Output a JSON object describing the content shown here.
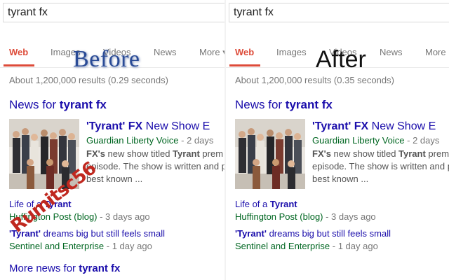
{
  "panels": {
    "before": {
      "query": "tyrant fx",
      "label": "Before",
      "tabs": [
        "Web",
        "Images",
        "Videos",
        "News",
        "More ▾"
      ],
      "stats": "About 1,200,000 results (0.29 seconds)",
      "news_heading_prefix": "News for ",
      "news_heading_query": "tyrant fx",
      "story": {
        "title_part1": "'Tyrant'",
        "title_part2": " FX",
        "title_part3": " New Show E",
        "publisher": "Guardian Liberty Voice",
        "age": " - 2 days",
        "snippet_bold1": "FX's",
        "snippet_mid1": " new show titled ",
        "snippet_bold2": "Tyrant",
        "snippet_tail1": " prem",
        "snippet2": "episode. The show is written and p",
        "snippet3": "best known ..."
      },
      "items": [
        {
          "title_plain": "Life of a ",
          "title_bold": "Tyrant",
          "publisher": "Huffington Post (blog)",
          "age": " - 3 days ago"
        },
        {
          "title_bold": "'Tyrant'",
          "title_plain": " dreams big but still feels small",
          "publisher": "Sentinel and Enterprise",
          "age": " - 1 day ago"
        }
      ],
      "more_news_prefix": "More news for ",
      "more_news_query": "tyrant fx",
      "watermark": "Rumitsc56"
    },
    "after": {
      "query": "tyrant fx",
      "label": "After",
      "tabs": [
        "Web",
        "Images",
        "Videos",
        "News",
        "More"
      ],
      "stats": "About 1,200,000 results (0.35 seconds)",
      "news_heading_prefix": "News for ",
      "news_heading_query": "tyrant fx",
      "story": {
        "title_part1": "'Tyrant'",
        "title_part2": " FX",
        "title_part3": " New Show E",
        "publisher": "Guardian Liberty Voice",
        "age": " - 2 days",
        "snippet_bold1": "FX's",
        "snippet_mid1": " new show titled ",
        "snippet_bold2": "Tyrant",
        "snippet_tail1": " prem",
        "snippet2": "episode. The show is written and p",
        "snippet3": "best known ..."
      },
      "items": [
        {
          "title_plain": "Life of a ",
          "title_bold": "Tyrant",
          "publisher": "Huffington Post (blog)",
          "age": " - 3 days ago"
        },
        {
          "title_bold": "'Tyrant'",
          "title_plain": " dreams big but still feels small",
          "publisher": "Sentinel and Enterprise",
          "age": " - 1 day ago"
        }
      ]
    }
  },
  "colors": {
    "link": "#1a0dab",
    "publisher_green": "#006621",
    "active_tab": "#dd4b39",
    "meta_gray": "#777777"
  }
}
